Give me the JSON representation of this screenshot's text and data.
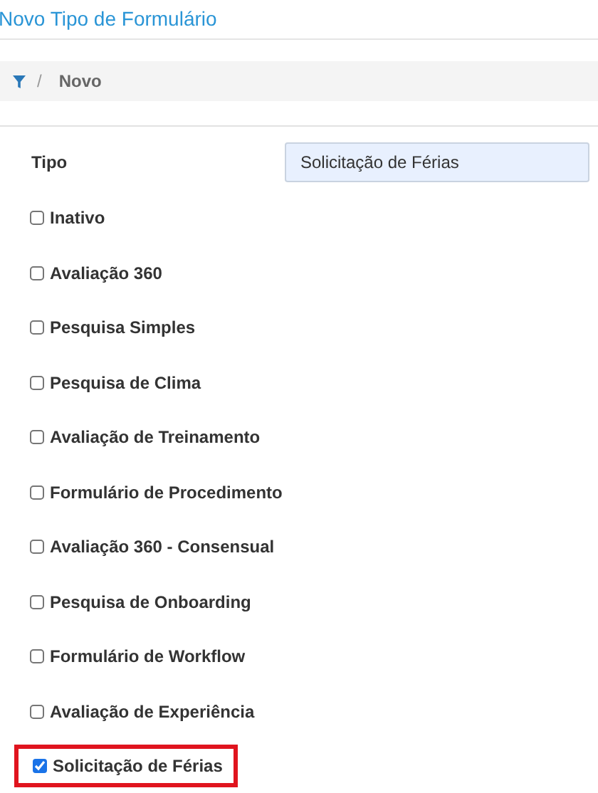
{
  "page_title": "Novo Tipo de Formulário",
  "breadcrumb": {
    "separator": "/",
    "current": "Novo"
  },
  "tipo": {
    "label": "Tipo",
    "value": "Solicitação de Férias"
  },
  "options": [
    {
      "label": "Inativo",
      "checked": false,
      "highlighted": false
    },
    {
      "label": "Avaliação 360",
      "checked": false,
      "highlighted": false
    },
    {
      "label": "Pesquisa Simples",
      "checked": false,
      "highlighted": false
    },
    {
      "label": "Pesquisa de Clima",
      "checked": false,
      "highlighted": false
    },
    {
      "label": "Avaliação de Treinamento",
      "checked": false,
      "highlighted": false
    },
    {
      "label": "Formulário de Procedimento",
      "checked": false,
      "highlighted": false
    },
    {
      "label": "Avaliação 360 - Consensual",
      "checked": false,
      "highlighted": false
    },
    {
      "label": "Pesquisa de Onboarding",
      "checked": false,
      "highlighted": false
    },
    {
      "label": "Formulário de Workflow",
      "checked": false,
      "highlighted": false
    },
    {
      "label": "Avaliação de Experiência",
      "checked": false,
      "highlighted": false
    },
    {
      "label": "Solicitação de Férias",
      "checked": true,
      "highlighted": true
    }
  ]
}
